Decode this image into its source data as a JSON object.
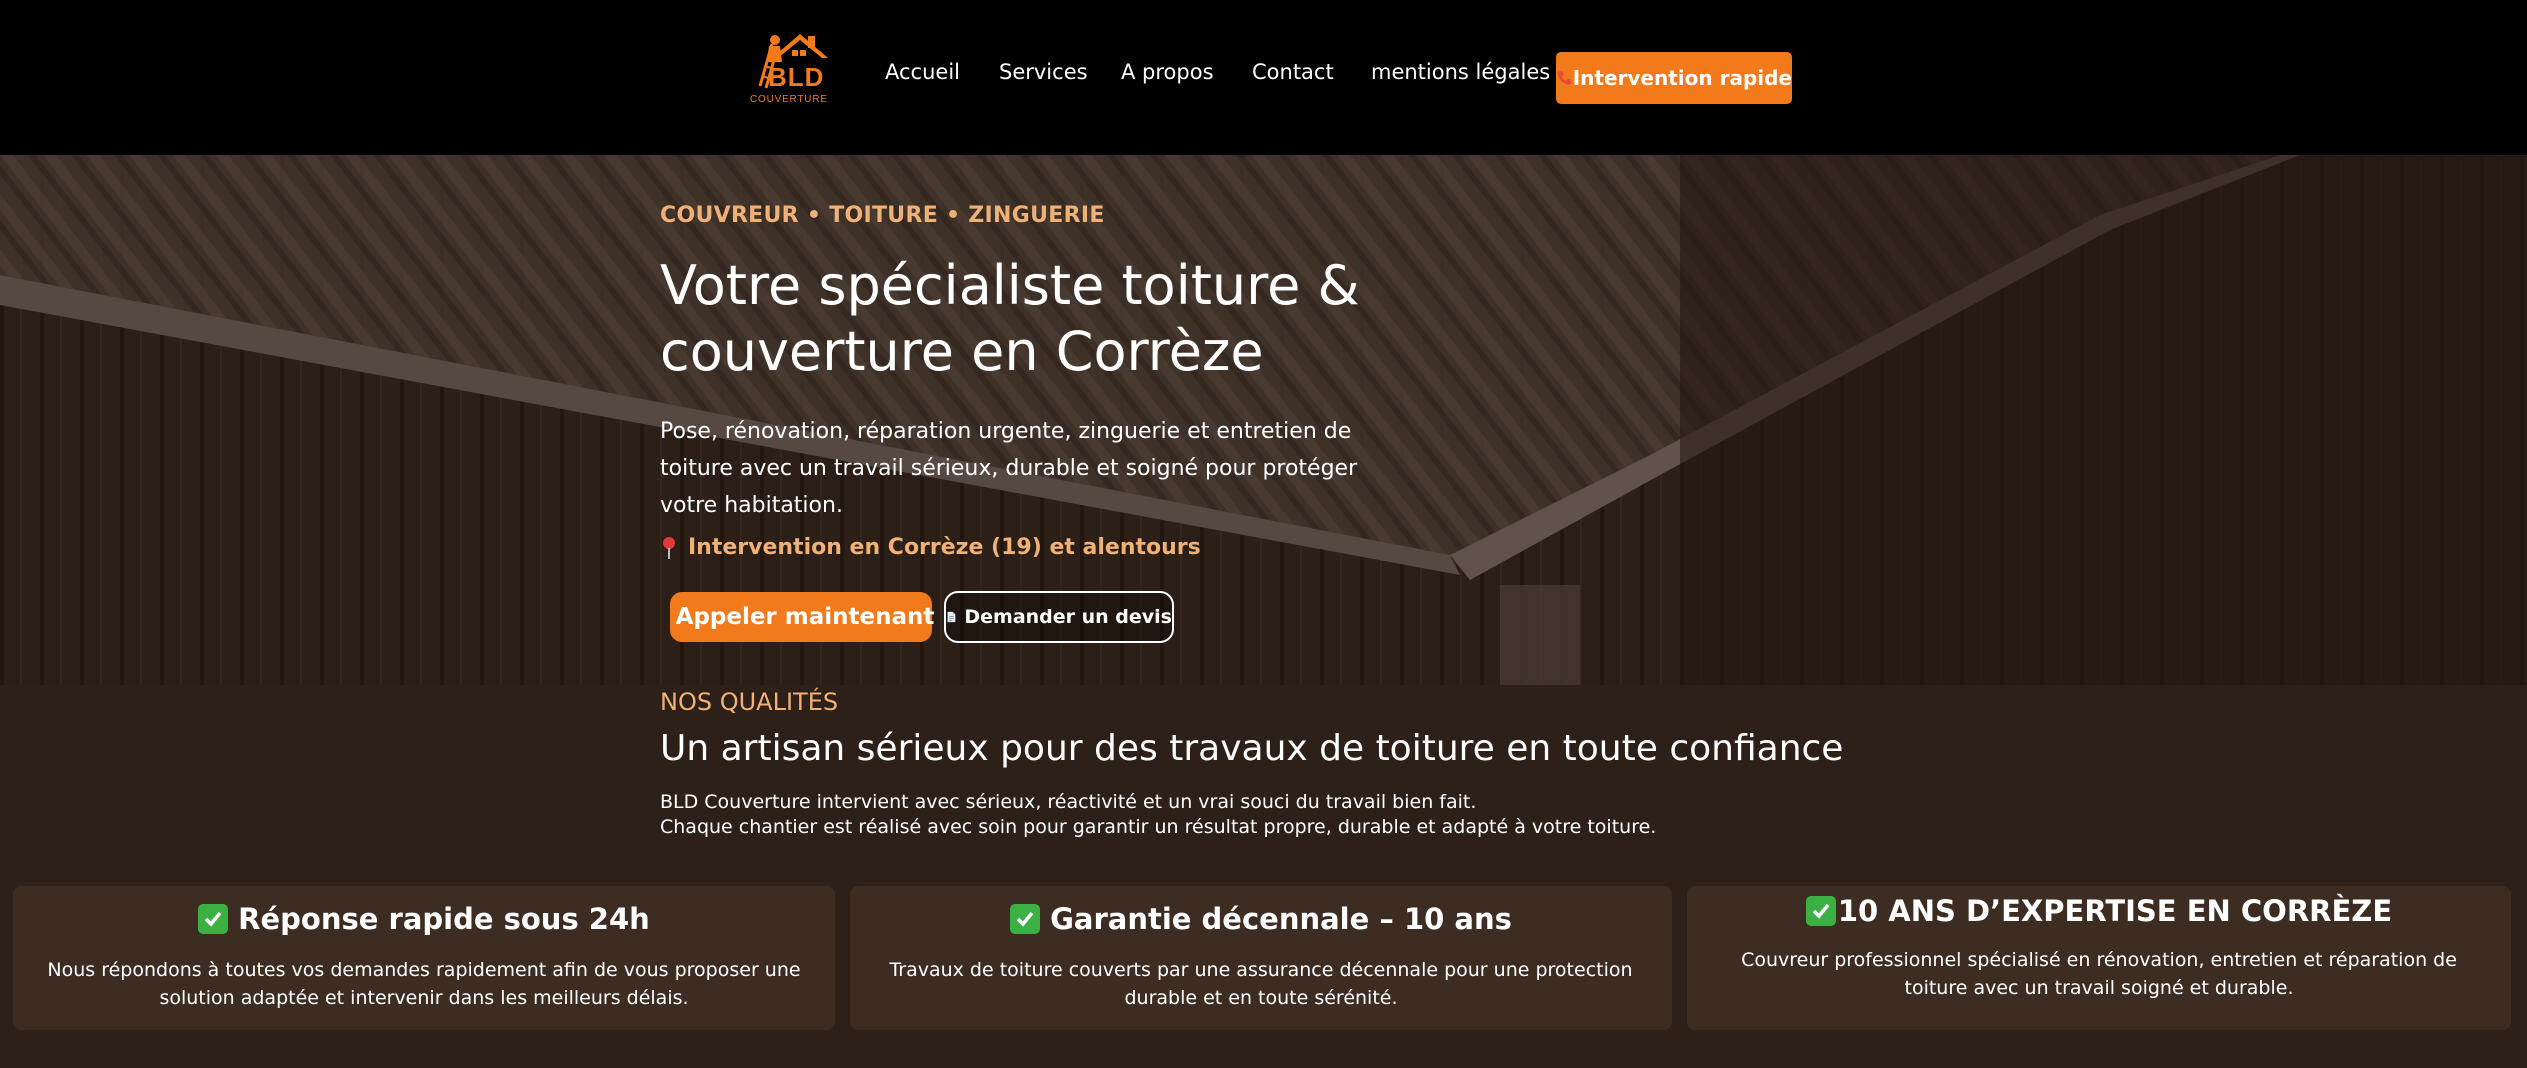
{
  "header": {
    "logo": {
      "name": "BLD",
      "tagline": "COUVERTURE"
    },
    "nav": [
      "Accueil",
      "Services",
      "A propos",
      "Contact",
      "mentions légales"
    ],
    "cta_label": "Intervention rapide",
    "cta_icon": "phone-icon"
  },
  "hero": {
    "eyebrow": "COUVREUR • TOITURE • ZINGUERIE",
    "title": "Votre spécialiste toiture & couverture en Corrèze",
    "text": "Pose, rénovation, réparation urgente, zinguerie et entretien de toiture avec un travail sérieux, durable et soigné pour protéger votre habitation.",
    "location": "Intervention en Corrèze (19) et alentours",
    "call_label": "Appeler maintenant",
    "quote_label": "Demander un devis"
  },
  "qualities": {
    "eyebrow": "NOS QUALITÉS",
    "title": "Un artisan sérieux pour des travaux de toiture en toute confiance",
    "text_line1": "BLD Couverture intervient avec sérieux, réactivité et un vrai souci du travail bien fait.",
    "text_line2": "Chaque chantier est réalisé avec soin pour garantir un résultat propre, durable et adapté à votre toiture.",
    "cards": [
      {
        "title": "Réponse rapide sous 24h",
        "text": "Nous répondons à toutes vos demandes rapidement afin de vous proposer une solution adaptée et intervenir dans les meilleurs délais."
      },
      {
        "title": "Garantie décennale – 10 ans",
        "text": "Travaux de toiture couverts par une assurance décennale pour une protection durable et en toute sérénité."
      },
      {
        "title": "10 ANS D’EXPERTISE EN CORRÈZE",
        "text": "Couvreur professionnel spécialisé en rénovation, entretien et réparation de toiture avec un travail soigné et durable."
      }
    ]
  },
  "colors": {
    "accent": "#f27a1a",
    "eyebrow": "#f0b177",
    "header_bg": "#000000",
    "section_bg": "#2c2019",
    "card_bg": "#3d2c22"
  }
}
